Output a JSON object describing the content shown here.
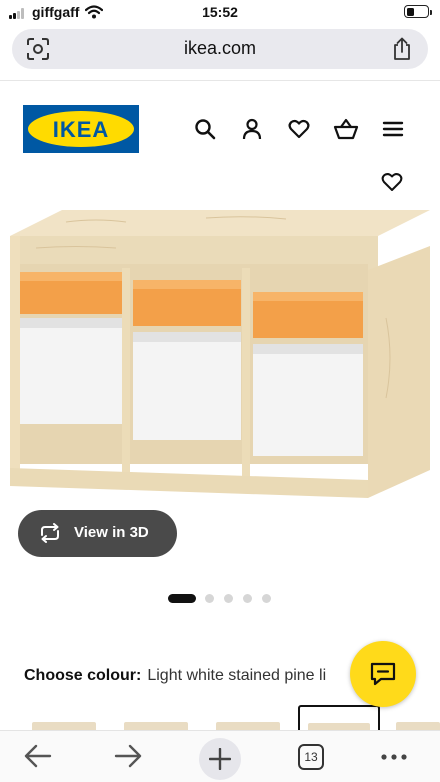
{
  "status_bar": {
    "carrier": "giffgaff",
    "time": "15:52",
    "signal_bars_filled": 2,
    "battery_level": 0.25
  },
  "browser": {
    "url": "ikea.com",
    "open_tabs": "13",
    "icons": [
      "camera-search-icon",
      "share-icon",
      "back-arrow-icon",
      "forward-arrow-icon",
      "new-tab-plus-icon",
      "tabs-icon",
      "more-icon"
    ]
  },
  "header": {
    "logo_text": "IKEA",
    "icons": [
      "search-icon",
      "user-icon",
      "heart-icon",
      "basket-icon",
      "menu-icon"
    ],
    "colors": {
      "logo_blue": "#0058a3",
      "logo_yellow": "#ffdb00"
    }
  },
  "product": {
    "wishlist_icon": "heart-outline-icon",
    "image_description": "pine storage unit with orange and white storage boxes",
    "view3d_label": "View in 3D",
    "carousel": {
      "count": 5,
      "active_index": 0
    }
  },
  "colour": {
    "label": "Choose colour:",
    "value": "Light white stained pine li"
  },
  "chat": {
    "icon": "chat-icon",
    "color": "#ffda1a"
  }
}
